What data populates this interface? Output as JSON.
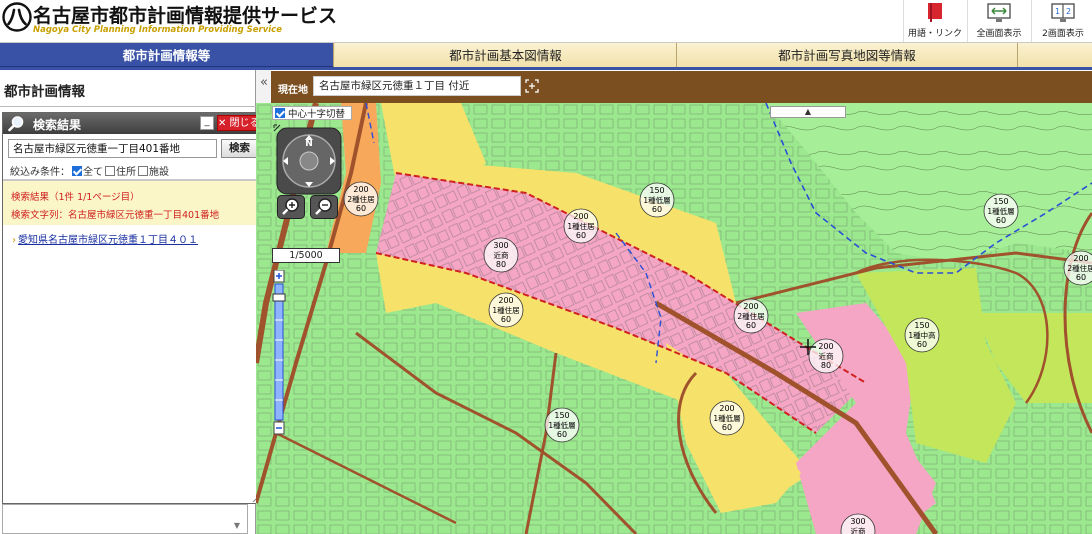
{
  "header": {
    "title_jp": "名古屋市都市計画情報提供サービス",
    "title_en": "Nagoya City Planning Information Providing Service",
    "buttons": [
      {
        "label": "用語・リンク",
        "icon": "book-icon"
      },
      {
        "label": "全画面表示",
        "icon": "fullscreen-icon"
      },
      {
        "label": "2画面表示",
        "icon": "dual-screen-icon"
      }
    ]
  },
  "tabs": [
    {
      "label": "都市計画情報等",
      "active": true
    },
    {
      "label": "都市計画基本図情報",
      "active": false
    },
    {
      "label": "都市計画写真地図等情報",
      "active": false
    },
    {
      "label": "",
      "active": false
    }
  ],
  "left_panel": {
    "title": "都市計画情報",
    "collapse_glyph": "«"
  },
  "search_result": {
    "title": "検索結果",
    "minimize_glyph": "_",
    "close_label": "✕ 閉じる",
    "input_value": "名古屋市緑区元徳重一丁目401番地",
    "search_button": "検索",
    "filter_label": "絞込み条件：",
    "filters": [
      {
        "label": "全て",
        "checked": true
      },
      {
        "label": "住所",
        "checked": false
      },
      {
        "label": "施設",
        "checked": false
      }
    ],
    "result_count": "検索結果（1件 1/1ページ目）",
    "result_query": "検索文字列：名古屋市緑区元徳重一丁目401番地",
    "result_link": "愛知県名古屋市緑区元徳重１丁目４０１"
  },
  "location": {
    "label": "現在地",
    "value": "名古屋市緑区元徳重１丁目 付近"
  },
  "map": {
    "cross_toggle_label": "中心十字切替",
    "scale": "1/5000",
    "colors": {
      "residential_low": "#9be88e",
      "residential_mid": "#c4e65a",
      "residential_high": "#f6e26a",
      "neighborhood_commercial": "#f4a6c4",
      "road_brown": "#a0522d",
      "boundary_blue": "#2a4fd6"
    },
    "zone_labels": [
      {
        "line1": "200",
        "line2": "2種住居",
        "line3": "60"
      },
      {
        "line1": "150",
        "line2": "1種低層",
        "line3": "60"
      },
      {
        "line1": "200",
        "line2": "1種住居",
        "line3": "60"
      },
      {
        "line1": "300",
        "line2": "近商",
        "line3": "80"
      },
      {
        "line1": "200",
        "line2": "1種住居",
        "line3": "60"
      },
      {
        "line1": "200",
        "line2": "2種住居",
        "line3": "60"
      },
      {
        "line1": "200",
        "line2": "近商",
        "line3": "80"
      },
      {
        "line1": "150",
        "line2": "1種中高",
        "line3": "60"
      },
      {
        "line1": "150",
        "line2": "1種低層",
        "line3": "60"
      },
      {
        "line1": "200",
        "line2": "1種低層",
        "line3": "60"
      },
      {
        "line1": "150",
        "line2": "1種低層",
        "line3": "60"
      },
      {
        "line1": "200",
        "line2": "2種住居",
        "line3": "60"
      },
      {
        "line1": "300",
        "line2": "近商",
        "line3": "80"
      }
    ]
  }
}
